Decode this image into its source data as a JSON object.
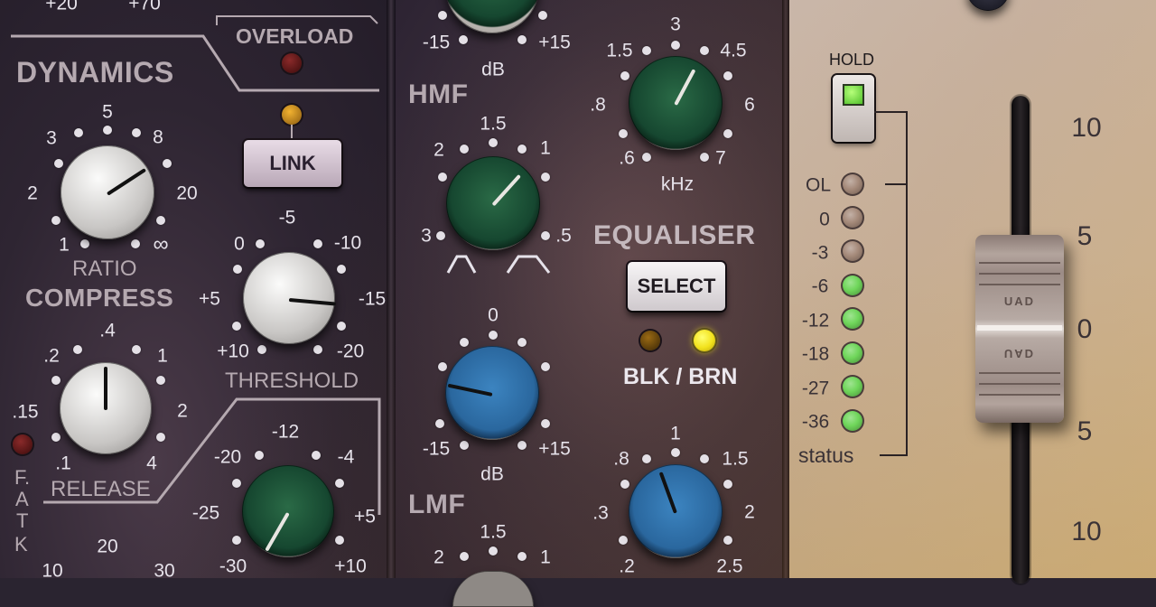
{
  "dynamics": {
    "top_ticks": [
      "+20",
      "+70"
    ],
    "section_title": "DYNAMICS",
    "overload_label": "OVERLOAD",
    "link_label": "LINK",
    "ratio": {
      "label": "RATIO",
      "ticks": [
        "1",
        "2",
        "3",
        "5",
        "8",
        "20",
        "∞"
      ]
    },
    "compress_label": "COMPRESS",
    "threshold": {
      "label": "THRESHOLD",
      "ticks": [
        "-5",
        "0",
        "-10",
        "+5",
        "-15",
        "+10",
        "-20"
      ]
    },
    "release": {
      "label": "RELEASE",
      "ticks": [
        ".4",
        ".2",
        "1",
        ".15",
        "2",
        ".1",
        "4"
      ]
    },
    "fast_attack_label": [
      "F.",
      "A",
      "T",
      "K"
    ],
    "makeup": {
      "ticks": [
        "-12",
        "-20",
        "-4",
        "-25",
        "+5",
        "-30",
        "+10"
      ]
    },
    "bottom_ticks": [
      "10",
      "20",
      "30"
    ]
  },
  "equaliser": {
    "hf_gain": {
      "ticks": [
        "-15",
        "+15"
      ],
      "unit": "dB"
    },
    "hf_freq": {
      "ticks": [
        "3",
        "1.5",
        "4.5",
        ".8",
        "6",
        ".6",
        "7"
      ],
      "unit": "kHz"
    },
    "hmf_label": "HMF",
    "hmf_q": {
      "ticks": [
        "1.5",
        "2",
        "1",
        "3",
        ".5"
      ]
    },
    "section_title": "EQUALISER",
    "select_label": "SELECT",
    "blk_brn_label": "BLK / BRN",
    "lmf_gain": {
      "ticks": [
        "0",
        "-15",
        "+15"
      ],
      "unit": "dB"
    },
    "lmf_label": "LMF",
    "lmf_freq": {
      "ticks": [
        "1",
        ".8",
        "1.5",
        ".3",
        "2",
        ".2",
        "2.5"
      ]
    },
    "lmf_q": {
      "ticks": [
        "1.5",
        "2",
        "1"
      ]
    }
  },
  "meter": {
    "hold_label": "HOLD",
    "leds": [
      {
        "label": "OL",
        "color": "#a58a7a"
      },
      {
        "label": "0",
        "color": "#a58a7a"
      },
      {
        "label": "-3",
        "color": "#a58a7a"
      },
      {
        "label": "-6",
        "color": "#6fd65a"
      },
      {
        "label": "-12",
        "color": "#6fd65a"
      },
      {
        "label": "-18",
        "color": "#6fd65a"
      },
      {
        "label": "-27",
        "color": "#6fd65a"
      },
      {
        "label": "-36",
        "color": "#6fd65a"
      }
    ],
    "status_label": "status",
    "fader_scale": [
      "10",
      "5",
      "0",
      "5",
      "10"
    ],
    "fader_cap_text": "UAD"
  },
  "colors": {
    "panel_dark": "#2c2433",
    "panel_light": "#cfc3b8",
    "knob_green": "#1f5a3c",
    "knob_blue": "#2e6fa8",
    "knob_silver": "#d8d6d2",
    "led_yellow": "#f2e21c"
  }
}
